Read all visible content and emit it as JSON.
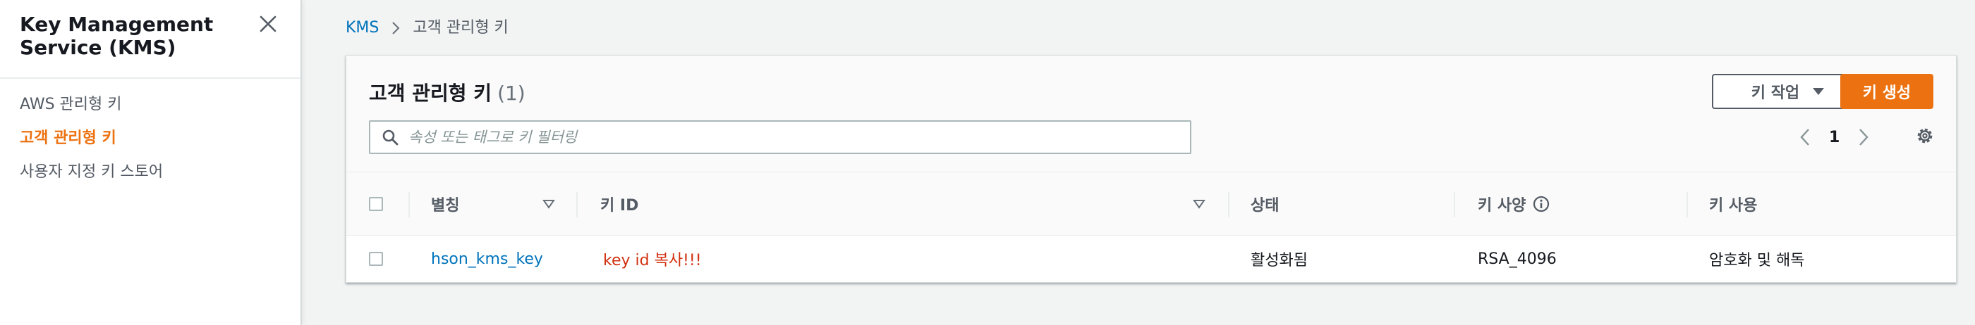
{
  "sidebar": {
    "title": "Key Management Service (KMS)",
    "close_icon": "close-icon",
    "items": [
      {
        "label": "AWS 관리형 키",
        "active": false
      },
      {
        "label": "고객 관리형 키",
        "active": true
      },
      {
        "label": "사용자 지정 키 스토어",
        "active": false
      }
    ]
  },
  "breadcrumb": {
    "root": "KMS",
    "current": "고객 관리형 키"
  },
  "panel": {
    "title": "고객 관리형 키",
    "count": "(1)",
    "actions_label": "키 작업",
    "create_label": "키 생성",
    "search_placeholder": "속성 또는 태그로 키 필터링",
    "page_number": "1"
  },
  "table": {
    "columns": [
      "별칭",
      "키 ID",
      "상태",
      "키 사양",
      "키 사용"
    ],
    "rows": [
      {
        "alias": "hson_kms_key",
        "key_id": "key id 복사!!!",
        "status": "활성화됨",
        "key_spec": "RSA_4096",
        "key_usage": "암호화 및 해독"
      }
    ]
  },
  "colors": {
    "accent": "#ec7211",
    "link": "#0073bb",
    "annotation_red": "#d13212"
  }
}
